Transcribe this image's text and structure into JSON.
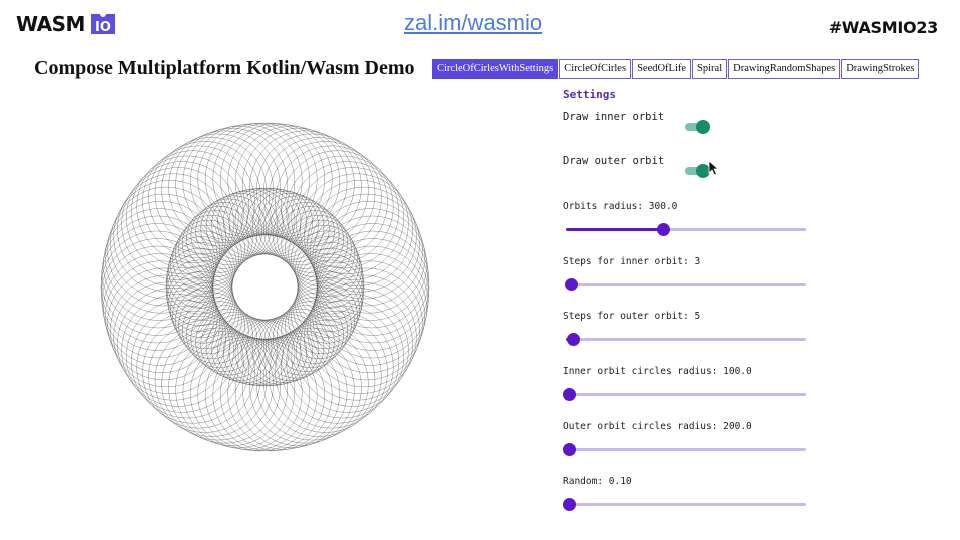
{
  "slide": {
    "logo_text": "WASM",
    "link_text": "zal.im/wasmio",
    "hashtag": "#WASMIO23"
  },
  "demo": {
    "title": "Compose Multiplatform Kotlin/Wasm Demo",
    "tabs": [
      {
        "label": "CircleOfCirlesWithSettings",
        "active": true
      },
      {
        "label": "CircleOfCirles",
        "active": false
      },
      {
        "label": "SeedOfLife",
        "active": false
      },
      {
        "label": "Spiral",
        "active": false
      },
      {
        "label": "DrawingRandomShapes",
        "active": false
      },
      {
        "label": "DrawingStrokes",
        "active": false
      }
    ]
  },
  "settings": {
    "title": "Settings",
    "toggles": [
      {
        "label": "Draw inner orbit",
        "on": true
      },
      {
        "label": "Draw outer orbit",
        "on": true
      }
    ],
    "sliders": [
      {
        "label": "Orbits radius: 300.0",
        "fraction": 0.39
      },
      {
        "label": "Steps for inner orbit: 3",
        "fraction": 0.01
      },
      {
        "label": "Steps for outer orbit: 5",
        "fraction": 0.015
      },
      {
        "label": "Inner orbit circles radius: 100.0",
        "fraction": 0.0
      },
      {
        "label": "Outer orbit circles radius: 200.0",
        "fraction": 0.0
      },
      {
        "label": "Random: 0.10",
        "fraction": 0.0
      }
    ]
  },
  "colors": {
    "accent": "#5b18c9",
    "tab_active": "#5a46e0",
    "toggle_on": "#178a6b",
    "link": "#4a7dd6"
  }
}
